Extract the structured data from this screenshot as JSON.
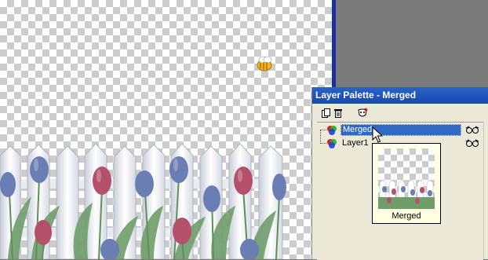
{
  "palette": {
    "title": "Layer Palette - Merged",
    "toolbar": {
      "new_layer_icon": "new-layer-icon",
      "delete_icon": "trash-icon",
      "mask_icon": "mask-icon"
    },
    "layers": [
      {
        "name": "Merged",
        "selected": true
      },
      {
        "name": "Layer1",
        "selected": false
      }
    ],
    "thumbnail_caption": "Merged"
  },
  "colors": {
    "title_bar": "#2b63c9",
    "selection": "#316ac5",
    "panel": "#ece9d8",
    "workspace": "#7b7b7b",
    "canvas_border": "#1a2fa0"
  }
}
